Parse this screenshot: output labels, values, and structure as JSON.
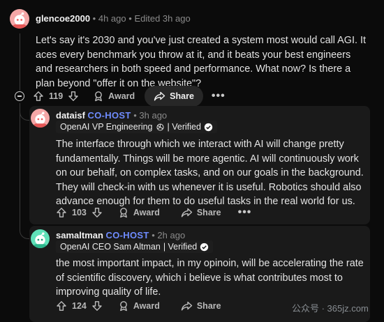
{
  "comments": [
    {
      "username": "glencoe2000",
      "meta_sep": "•",
      "time": "4h ago",
      "edited": "Edited 3h ago",
      "body": "Let's say it's 2030 and you've just created a system most would call AGI. It aces every benchmark you throw at it, and it beats your best engineers and researchers in both speed and performance. What now? Is there a plan beyond \"offer it on the website\"?",
      "votes": "119",
      "award_label": "Award",
      "share_label": "Share",
      "more_label": "•••",
      "avatar_color": "#f4a7a7"
    },
    {
      "username": "dataisf",
      "role": "CO-HOST",
      "meta_sep": "•",
      "time": "3h ago",
      "flair": "OpenAI VP Engineering",
      "flair_verified": "| Verified",
      "body": "The interface through which we interact with AI will change pretty fundamentally. Things will be more agentic. AI will continuously work on our behalf, on complex tasks, and on our goals in the background. They will check-in with us whenever it is useful. Robotics should also advance enough for them to do useful tasks in the real world for us.",
      "votes": "103",
      "award_label": "Award",
      "share_label": "Share",
      "more_label": "•••",
      "avatar_color": "#f4a7a7"
    },
    {
      "username": "samaltman",
      "role": "CO-HOST",
      "meta_sep": "•",
      "time": "2h ago",
      "flair": "OpenAI CEO Sam Altman",
      "flair_verified": "| Verified",
      "body": "the most important impact, in my opinoin, will be accelerating the rate of scientific discovery, which i believe is what contributes most to improving quality of life.",
      "votes": "124",
      "award_label": "Award",
      "share_label": "Share",
      "more_label": "•••",
      "avatar_color": "#5fe0b8"
    }
  ],
  "watermark": "公众号 · 365jz.com"
}
